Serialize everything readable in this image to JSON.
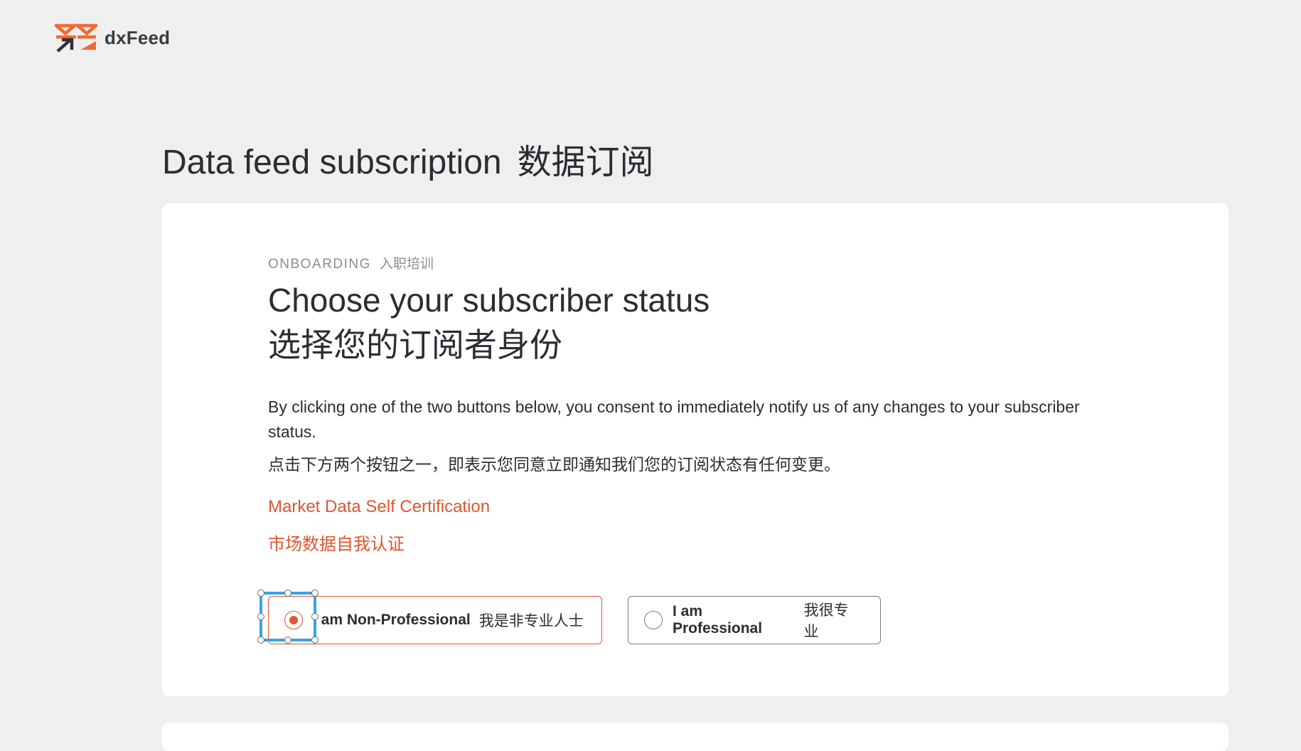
{
  "logo": {
    "text": "dxFeed",
    "icon": "dxfeed-logo-icon"
  },
  "page_title": {
    "en": "Data feed subscription",
    "zh": "数据订阅"
  },
  "card": {
    "eyebrow": {
      "en": "ONBOARDING",
      "zh": "入职培训"
    },
    "heading": {
      "en": "Choose your subscriber status",
      "zh": "选择您的订阅者身份"
    },
    "description": {
      "en": "By clicking one of the two buttons below, you consent to immediately notify us of any changes to your subscriber status.",
      "zh": "点击下方两个按钮之一，即表示您同意立即通知我们您的订阅状态有任何变更。"
    },
    "certification_link": {
      "en": "Market Data Self Certification",
      "zh": "市场数据自我认证"
    },
    "options": [
      {
        "en": "I am Non-Professional",
        "zh": "我是非专业人士",
        "selected": true
      },
      {
        "en": "I am Professional",
        "zh": "我很专业",
        "selected": false
      }
    ]
  },
  "colors": {
    "accent": "#e0562f",
    "selection_outline": "#3aa3e3",
    "background": "#efefef",
    "card": "#ffffff",
    "text": "#2b2d33",
    "muted": "#8a8d94"
  }
}
